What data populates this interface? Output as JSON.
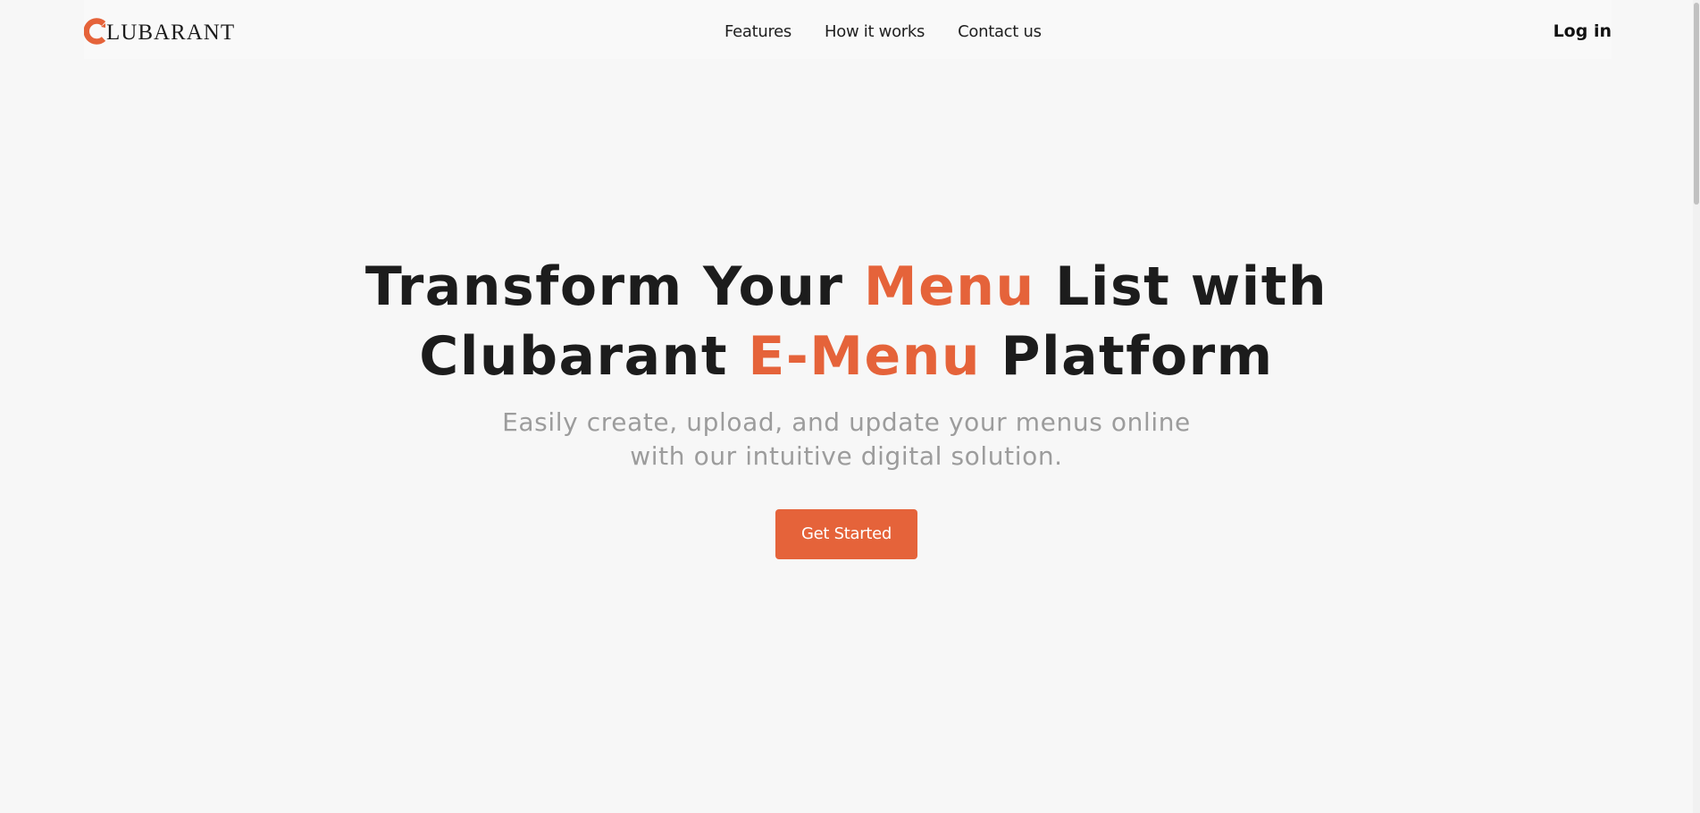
{
  "header": {
    "logo_initial": "C",
    "logo_text": "LUBARANT",
    "nav": [
      {
        "label": "Features"
      },
      {
        "label": "How it works"
      },
      {
        "label": "Contact us"
      }
    ],
    "login_label": "Log in"
  },
  "hero": {
    "title_line1_a": "Transform Your ",
    "title_line1_accent": "Menu",
    "title_line1_b": " List with",
    "title_line2_a": "Clubarant ",
    "title_line2_accent": "E-Menu",
    "title_line2_b": " Platform",
    "subtitle_line1": "Easily create, upload, and update your menus online",
    "subtitle_line2": "with our intuitive digital solution.",
    "cta_label": "Get Started"
  },
  "colors": {
    "accent": "#e5633a",
    "background": "#f7f7f7",
    "text": "#1c1c1c",
    "muted": "#9c9c9c"
  }
}
